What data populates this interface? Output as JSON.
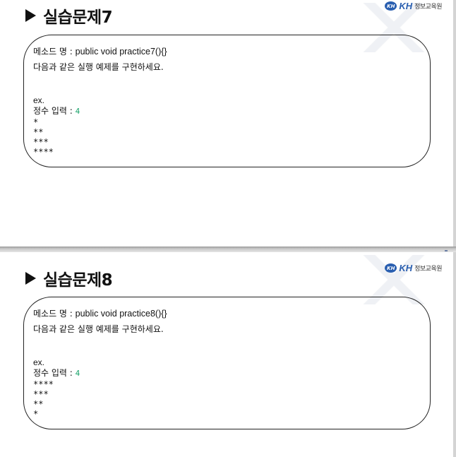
{
  "logo": {
    "badge": "KH",
    "brand": "KH",
    "org": "정보교육원"
  },
  "slides": [
    {
      "title": "실습문제7",
      "method_label": "메소드 명 : ",
      "method_sig": "public void practice7(){}",
      "instruction": "다음과 같은 실행 예제를 구현하세요.",
      "ex_label": "ex.",
      "input_label": "정수 입력 : ",
      "input_value": "4",
      "output": [
        "*",
        "**",
        "***",
        "****"
      ]
    },
    {
      "title": "실습문제8",
      "method_label": "메소드 명 : ",
      "method_sig": "public void practice8(){}",
      "instruction": "다음과 같은 실행 예제를 구현하세요.",
      "ex_label": "ex.",
      "input_label": "정수 입력 : ",
      "input_value": "4",
      "output": [
        "****",
        "***",
        "**",
        "*"
      ]
    }
  ]
}
